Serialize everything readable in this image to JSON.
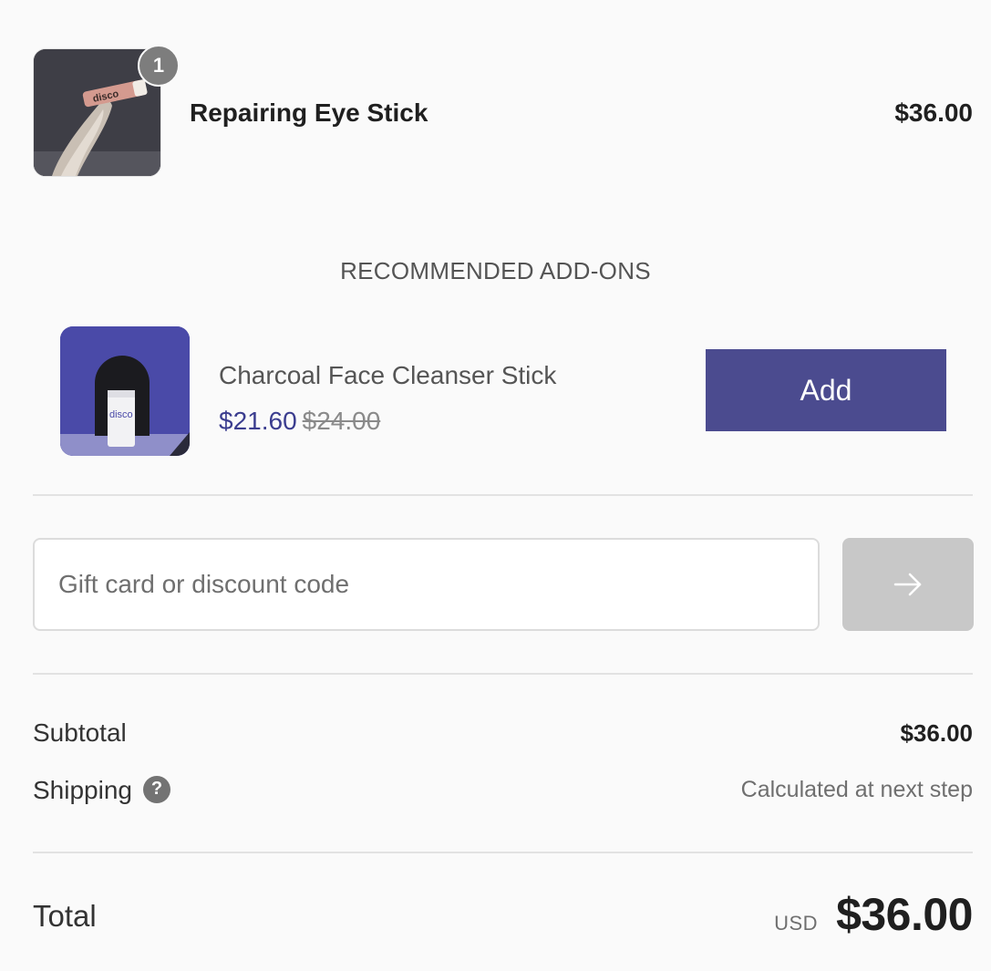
{
  "cart": {
    "item": {
      "quantity": "1",
      "name": "Repairing Eye Stick",
      "price": "$36.00",
      "image_text": "disco"
    }
  },
  "addons": {
    "heading": "RECOMMENDED ADD-ONS",
    "item": {
      "name": "Charcoal Face Cleanser Stick",
      "sale_price": "$21.60",
      "original_price": "$24.00",
      "image_text": "disco",
      "button_label": "Add"
    }
  },
  "discount": {
    "placeholder": "Gift card or discount code",
    "value": ""
  },
  "summary": {
    "subtotal_label": "Subtotal",
    "subtotal_value": "$36.00",
    "shipping_label": "Shipping",
    "shipping_value": "Calculated at next step",
    "help_glyph": "?",
    "total_label": "Total",
    "currency": "USD",
    "total_value": "$36.00"
  },
  "colors": {
    "accent": "#4b4b8f",
    "sale_price": "#3b3d8f",
    "background": "#fafafa",
    "disabled_button": "#c8c8c8"
  },
  "icons": {
    "apply": "arrow-right-icon",
    "shipping_help": "question-circle-icon"
  }
}
